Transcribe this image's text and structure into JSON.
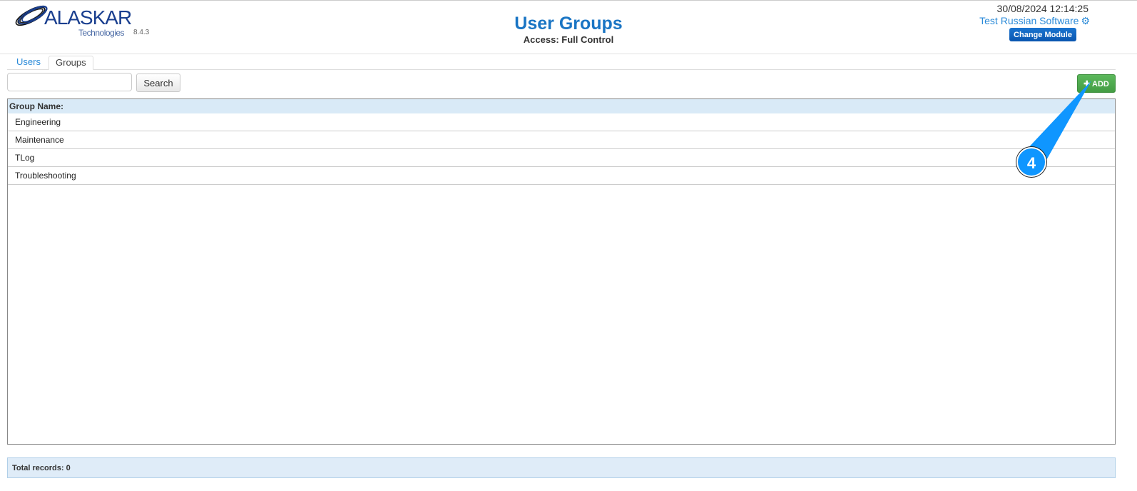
{
  "header": {
    "brand": "ALASKAR",
    "brand_sub": "Technologies",
    "version": "8.4.3",
    "title": "User Groups",
    "access": "Access: Full Control",
    "datetime": "30/08/2024 12:14:25",
    "company": "Test Russian Software",
    "change_module": "Change Module"
  },
  "tabs": [
    {
      "label": "Users"
    },
    {
      "label": "Groups"
    }
  ],
  "toolbar": {
    "search_value": "",
    "search_label": "Search",
    "add_label": "ADD",
    "add_icon": "plus-icon"
  },
  "table": {
    "header": "Group Name:",
    "rows": [
      "Engineering",
      "Maintenance",
      "TLog",
      "Troubleshooting"
    ]
  },
  "footer": {
    "total": "Total records: 0"
  },
  "annotation": {
    "number": "4",
    "color": "#0f96ff"
  },
  "colors": {
    "accent": "#1a75c4",
    "add_green": "#5cb85c",
    "header_bg": "#d9eaf7"
  }
}
